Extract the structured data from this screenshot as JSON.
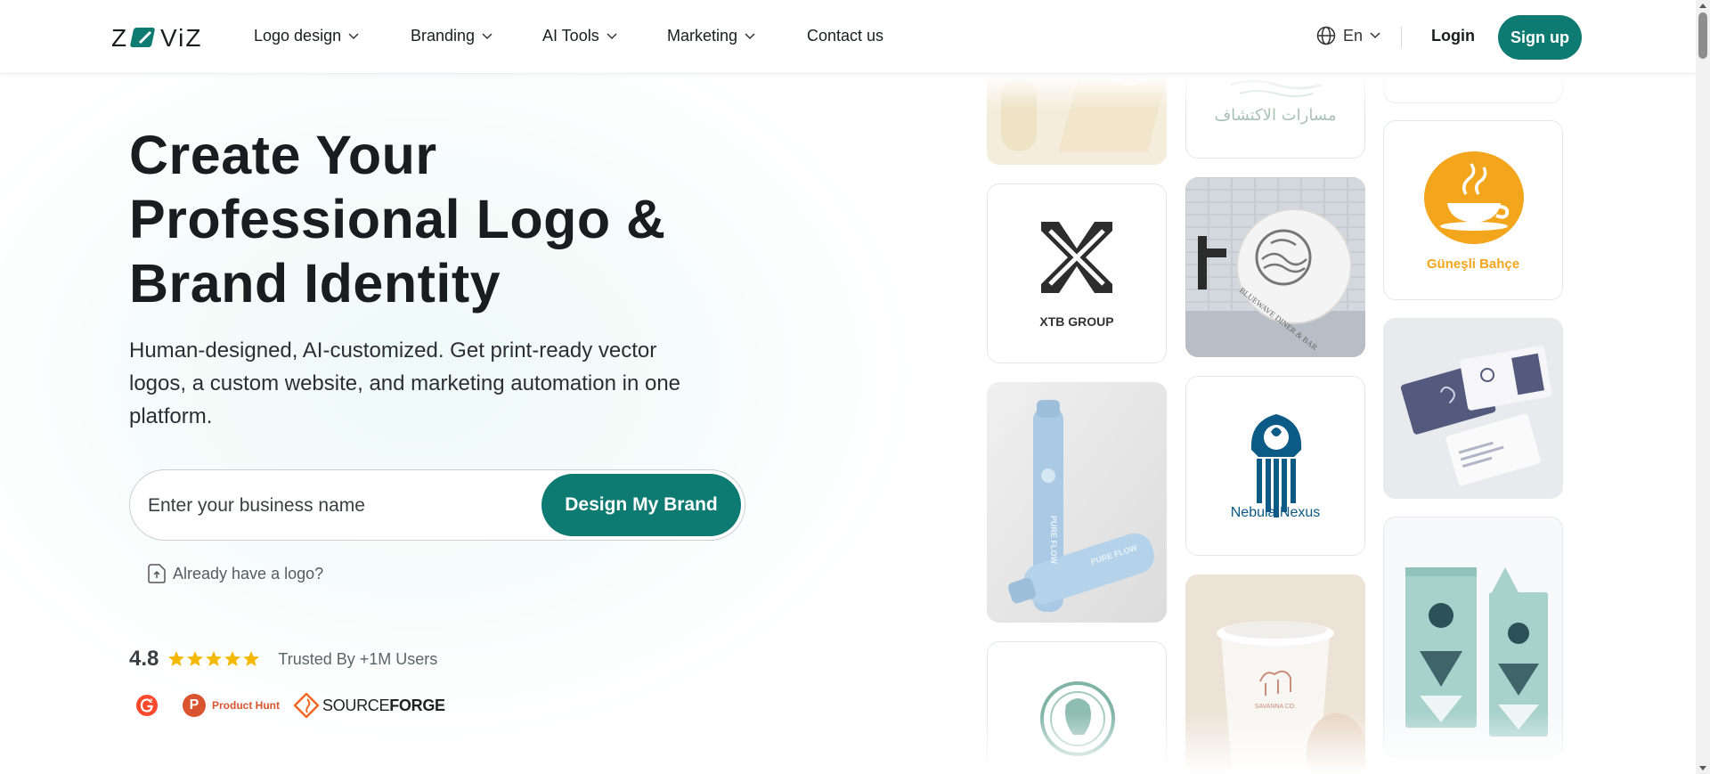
{
  "brand": {
    "name": "ZOVIZ",
    "accent": "#0e7b72",
    "star_color": "#f5b800"
  },
  "nav": {
    "items": [
      {
        "label": "Logo design",
        "dropdown": true
      },
      {
        "label": "Branding",
        "dropdown": true
      },
      {
        "label": "AI Tools",
        "dropdown": true
      },
      {
        "label": "Marketing",
        "dropdown": true
      },
      {
        "label": "Contact us",
        "dropdown": false
      }
    ],
    "language": "En",
    "login": "Login",
    "signup": "Sign up"
  },
  "hero": {
    "title_lines": [
      "Create Your",
      "Professional Logo &",
      "Brand Identity"
    ],
    "subtitle_lines": [
      "Human-designed, AI-customized. Get print-ready vector",
      "logos, a custom website, and marketing automation in one",
      "platform."
    ],
    "search_placeholder": "Enter your business name",
    "cta": "Design My Brand",
    "have_logo": "Already have a logo?",
    "rating": "4.8",
    "stars": 5,
    "trusted": "Trusted By +1M Users",
    "badges": {
      "producthunt": "Product Hunt",
      "sourceforge_light": "SOURCE",
      "sourceforge_bold": "FORGE"
    }
  },
  "gallery": {
    "arabic_text": "مسارات الاكتشاف",
    "xtb": "XTB GROUP",
    "bluewave": "BLUEWAVE DINER & BAR",
    "gunesli": "Güneşli Bahçe",
    "nebula": "Nebula Nexus",
    "pure_flow": "PURE FLOW",
    "savanna": "SAVANNA CO."
  }
}
